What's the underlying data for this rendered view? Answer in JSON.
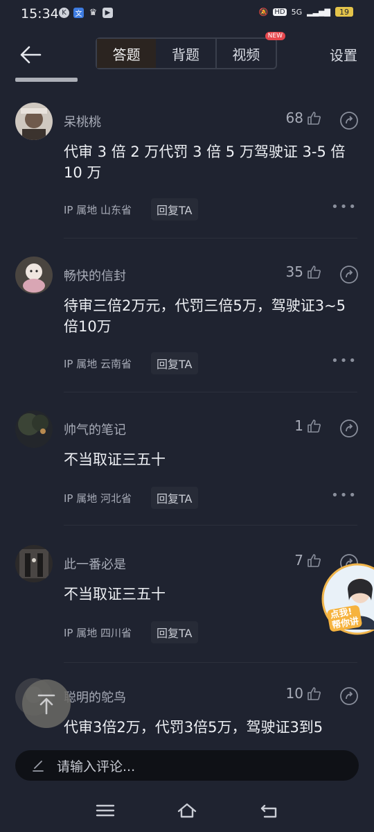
{
  "status": {
    "time": "15:34",
    "battery": "19",
    "hd": "HD",
    "net": "5G"
  },
  "header": {
    "tabs": [
      {
        "label": "答题"
      },
      {
        "label": "背题"
      },
      {
        "label": "视频",
        "badge": "NEW"
      }
    ],
    "settings": "设置"
  },
  "comments": [
    {
      "name": "呆桃桃",
      "likes": "68",
      "content": "代审 3 倍 2 万代罚 3 倍 5 万驾驶证 3-5 倍 10 万",
      "ip": "IP 属地 山东省",
      "reply": "回复TA"
    },
    {
      "name": "畅快的信封",
      "likes": "35",
      "content": "待审三倍2万元，代罚三倍5万，驾驶证3~5倍10万",
      "ip": "IP 属地 云南省",
      "reply": "回复TA"
    },
    {
      "name": "帅气的笔记",
      "likes": "1",
      "content": "不当取证三五十",
      "ip": "IP 属地 河北省",
      "reply": "回复TA"
    },
    {
      "name": "此一番必是",
      "likes": "7",
      "content": "不当取证三五十",
      "ip": "IP 属地 四川省",
      "reply": "回复TA"
    },
    {
      "name": "聪明的鸵鸟",
      "likes": "10",
      "content": "代审3倍2万，代罚3倍5万，驾驶证3到5",
      "ip": "",
      "reply": ""
    }
  ],
  "helper": {
    "label_line1": "点我!",
    "label_line2": "帮你讲"
  },
  "input": {
    "placeholder": "请输入评论..."
  }
}
